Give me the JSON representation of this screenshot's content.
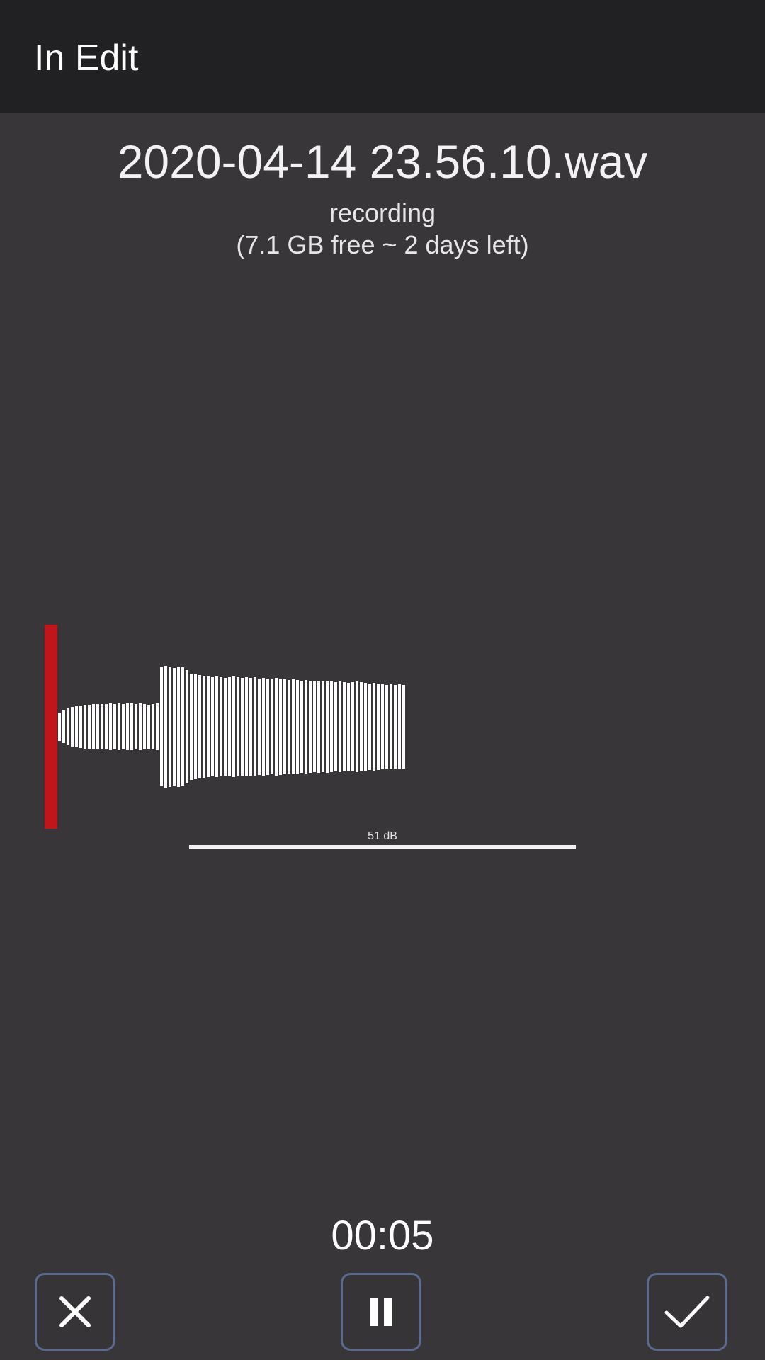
{
  "app_bar": {
    "title": "In Edit"
  },
  "recording": {
    "file_name": "2020-04-14 23.56.10.wav",
    "status": "recording",
    "storage_info": "(7.1 GB free ~ 2 days left)",
    "level_label": "51 dB",
    "elapsed_time": "00:05"
  },
  "controls": {
    "cancel_icon": "close-icon",
    "pause_icon": "pause-icon",
    "confirm_icon": "check-icon"
  },
  "colors": {
    "background": "#383639",
    "app_bar": "#212023",
    "playhead": "#c0161b",
    "waveform": "#ffffff",
    "button_border": "#5a6a90"
  }
}
